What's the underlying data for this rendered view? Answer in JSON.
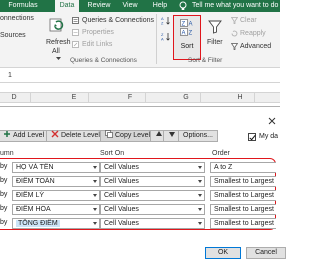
{
  "ribbon": {
    "tabs": [
      {
        "label": "Formulas",
        "active": false
      },
      {
        "label": "Data",
        "active": true
      },
      {
        "label": "Review",
        "active": false
      },
      {
        "label": "View",
        "active": false
      },
      {
        "label": "Help",
        "active": false
      }
    ],
    "tell_me": "Tell me what you want to do",
    "get_data_partial": "onnections",
    "sources_partial": "Sources",
    "refresh_line1": "Refresh",
    "refresh_line2": "All",
    "queries_connections": "Queries & Connections",
    "properties": "Properties",
    "edit_links": "Edit Links",
    "queries_group_label": "Queries & Connections",
    "sort_az": "A→Z",
    "sort_za": "Z→A",
    "sort_label": "Sort",
    "filter_label": "Filter",
    "clear_label": "Clear",
    "reapply_label": "Reapply",
    "advanced_label": "Advanced",
    "sort_filter_group_label": "Sort & Filter"
  },
  "formula_bar": {
    "value": "1"
  },
  "grid": {
    "columns": [
      "D",
      "E",
      "F",
      "G",
      "H"
    ]
  },
  "sort_dialog": {
    "add_level": "Add Level",
    "delete_level": "Delete Level",
    "copy_level": "Copy Level",
    "options": "Options...",
    "my_data_headers": "My da",
    "headers": {
      "column": "umn",
      "sort_on": "Sort On",
      "order": "Order"
    },
    "rows": [
      {
        "label": "by",
        "column": "HỌ VÀ TÊN",
        "sort_on": "Cell Values",
        "order": "A to Z",
        "selected": false
      },
      {
        "label": "by",
        "column": "ĐIỂM TOÁN",
        "sort_on": "Cell Values",
        "order": "Smallest to Largest",
        "selected": false
      },
      {
        "label": "by",
        "column": "ĐIỂM LÝ",
        "sort_on": "Cell Values",
        "order": "Smallest to Largest",
        "selected": false
      },
      {
        "label": "by",
        "column": "ĐIỂM HÓA",
        "sort_on": "Cell Values",
        "order": "Smallest to Largest",
        "selected": false
      },
      {
        "label": "by",
        "column": "TỔNG ĐIỂM",
        "sort_on": "Cell Values",
        "order": "Smallest to Largest",
        "selected": true
      }
    ],
    "ok": "OK",
    "cancel": "Cancel"
  },
  "colors": {
    "brand": "#217346",
    "highlight": "#e0161c",
    "selection": "#cce4f7"
  }
}
